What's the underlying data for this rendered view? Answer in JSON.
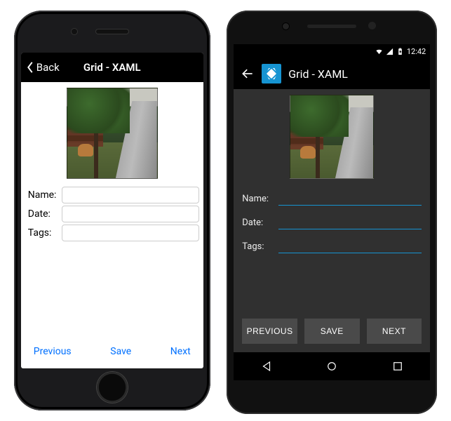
{
  "ios": {
    "back_label": "Back",
    "title": "Grid - XAML",
    "labels": {
      "name": "Name:",
      "date": "Date:",
      "tags": "Tags:"
    },
    "values": {
      "name": "",
      "date": "",
      "tags": ""
    },
    "buttons": {
      "previous": "Previous",
      "save": "Save",
      "next": "Next"
    }
  },
  "android": {
    "status": {
      "time": "12:42"
    },
    "title": "Grid - XAML",
    "labels": {
      "name": "Name:",
      "date": "Date:",
      "tags": "Tags:"
    },
    "values": {
      "name": "",
      "date": "",
      "tags": ""
    },
    "buttons": {
      "previous": "PREVIOUS",
      "save": "SAVE",
      "next": "NEXT"
    }
  }
}
